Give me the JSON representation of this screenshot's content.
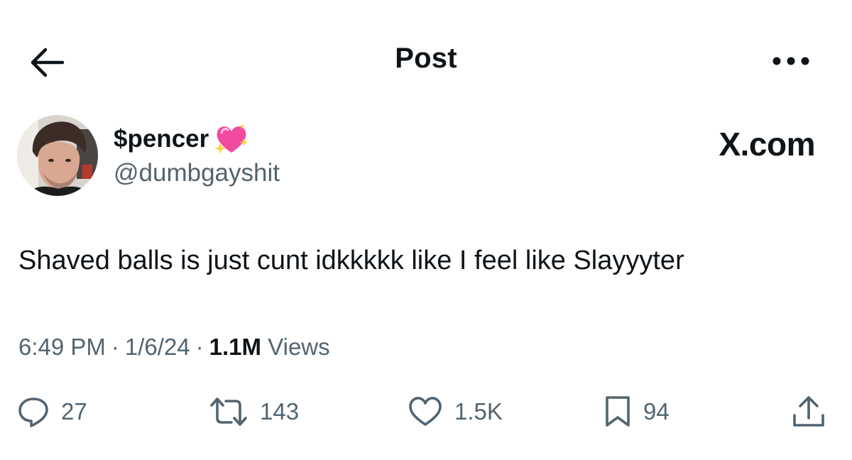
{
  "header": {
    "title": "Post",
    "back_icon": "arrow-left-icon",
    "more_icon": "more-horizontal-icon"
  },
  "author": {
    "display_name": "$pencer",
    "emoji": "sparkling-heart-emoji",
    "handle": "@dumbgayshit"
  },
  "watermark": "X.com",
  "tweet": {
    "text": "Shaved balls is just cunt idkkkkk like I feel like Slayyyter"
  },
  "meta": {
    "time": "6:49 PM",
    "separator": "·",
    "date": "1/6/24",
    "views_count": "1.1M",
    "views_label": "Views"
  },
  "actions": {
    "replies": "27",
    "reposts": "143",
    "likes": "1.5K",
    "bookmarks": "94"
  },
  "colors": {
    "text_primary": "#0f1419",
    "text_secondary": "#536471",
    "emoji_pink": "#f04b9e"
  }
}
